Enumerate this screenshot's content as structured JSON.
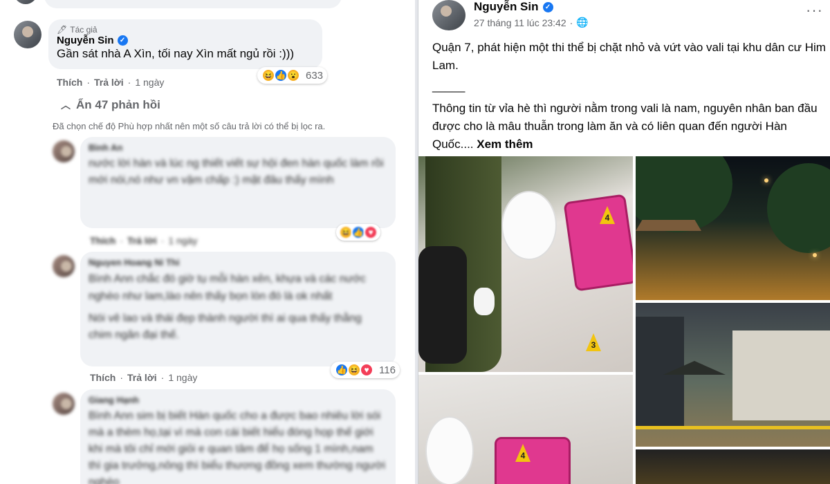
{
  "left": {
    "top_reply_actions": "",
    "author_comment": {
      "tag": "Tác giả",
      "name": "Nguyễn Sin",
      "text": "Gần sát nhà A Xìn, tối nay Xìn mất ngủ rồi :)))",
      "like": "Thích",
      "reply": "Trả lời",
      "time": "1 ngày",
      "reaction_count": "633"
    },
    "hidden_replies": "Ẩn 47 phản hồi",
    "filter_note": "Đã chọn chế độ Phù hợp nhất nên một số câu trả lời có thể bị lọc ra.",
    "comments": [
      {
        "name": "Bình An",
        "text_visible": "nước lời hàn và lúc ng thiết viết sự hội đen hàn quốc làm rồi mới nói,nó như vn vậm chấp :) mặt đâu thấy mình",
        "like": "Thích",
        "reply": "Trả lời",
        "time": "1 ngày"
      },
      {
        "name": "Nguyen Hoang Ni Thi",
        "text_visible": "Bình Ann chắc đó giờ tụ mỗi hàn xẻn, khựa và các nước nghèo như lam,lào nên thấy bọn lòn đó là ok nhất",
        "text_visible2": "Nói vê lao và thái đẹp thành người thì ai qua thấy thằng chim ngăn đại thế.",
        "like": "Thích",
        "reply": "Trả lời",
        "time": "1 ngày",
        "reaction_count": "116"
      },
      {
        "name": "Giang Hạnh",
        "text_visible": "Bình Ann sim bị biết Hàn quốc cho a được bao nhiêu lời sói mà a thèm họ,tại vì mà con cái biết hiểu đóng họp thế giới khi mà tôi chỉ mới giỏi e quan tâm để họ sống 1 mình,nam thì gia trưởng,nông thì biểu thương đồng xem thường người nghèo",
        "like": "",
        "reply": "",
        "time": ""
      }
    ]
  },
  "post": {
    "author": "Nguyễn Sin",
    "timestamp": "27 tháng 11 lúc 23:42",
    "more": "···",
    "paragraph1": "Quận 7, phát hiện một thi thể bị chặt nhỏ và vứt vào vali tại khu dân cư Him Lam.",
    "separator": "_____",
    "paragraph2": "Thông tin từ vỉa hè thì người nằm trong vali là nam, nguyên nhân ban đầu được cho là mâu thuẫn trong làm ăn và có liên quan đến người Hàn Quốc....",
    "see_more": "Xem thêm",
    "markers": [
      "4",
      "3",
      "4"
    ]
  }
}
